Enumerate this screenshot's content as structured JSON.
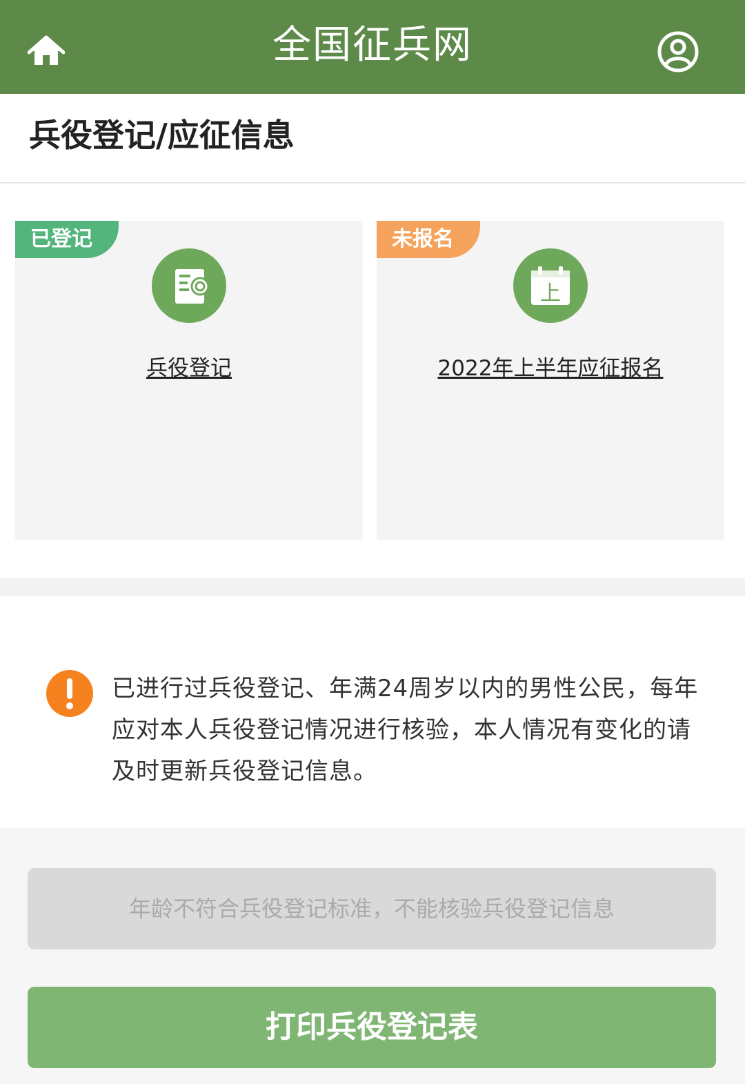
{
  "header": {
    "title": "全国征兵网",
    "home_icon": "home-icon",
    "user_icon": "user-icon",
    "color": "#5d8a48"
  },
  "page": {
    "section_title": "兵役登记/应征信息"
  },
  "cards": [
    {
      "badge": "已登记",
      "badge_color": "#53b57c",
      "icon": "registration-document-icon",
      "link": "兵役登记"
    },
    {
      "badge": "未报名",
      "badge_color": "#f5a25c",
      "icon": "calendar-icon",
      "icon_text": "上",
      "link": "2022年上半年应征报名"
    }
  ],
  "notice": {
    "icon": "alert-icon",
    "text": "已进行过兵役登记、年满24周岁以内的男性公民，每年应对本人兵役登记情况进行核验，本人情况有变化的请及时更新兵役登记信息。"
  },
  "buttons": {
    "verify_disabled": "年龄不符合兵役登记标准，不能核验兵役登记信息",
    "print": "打印兵役登记表"
  }
}
